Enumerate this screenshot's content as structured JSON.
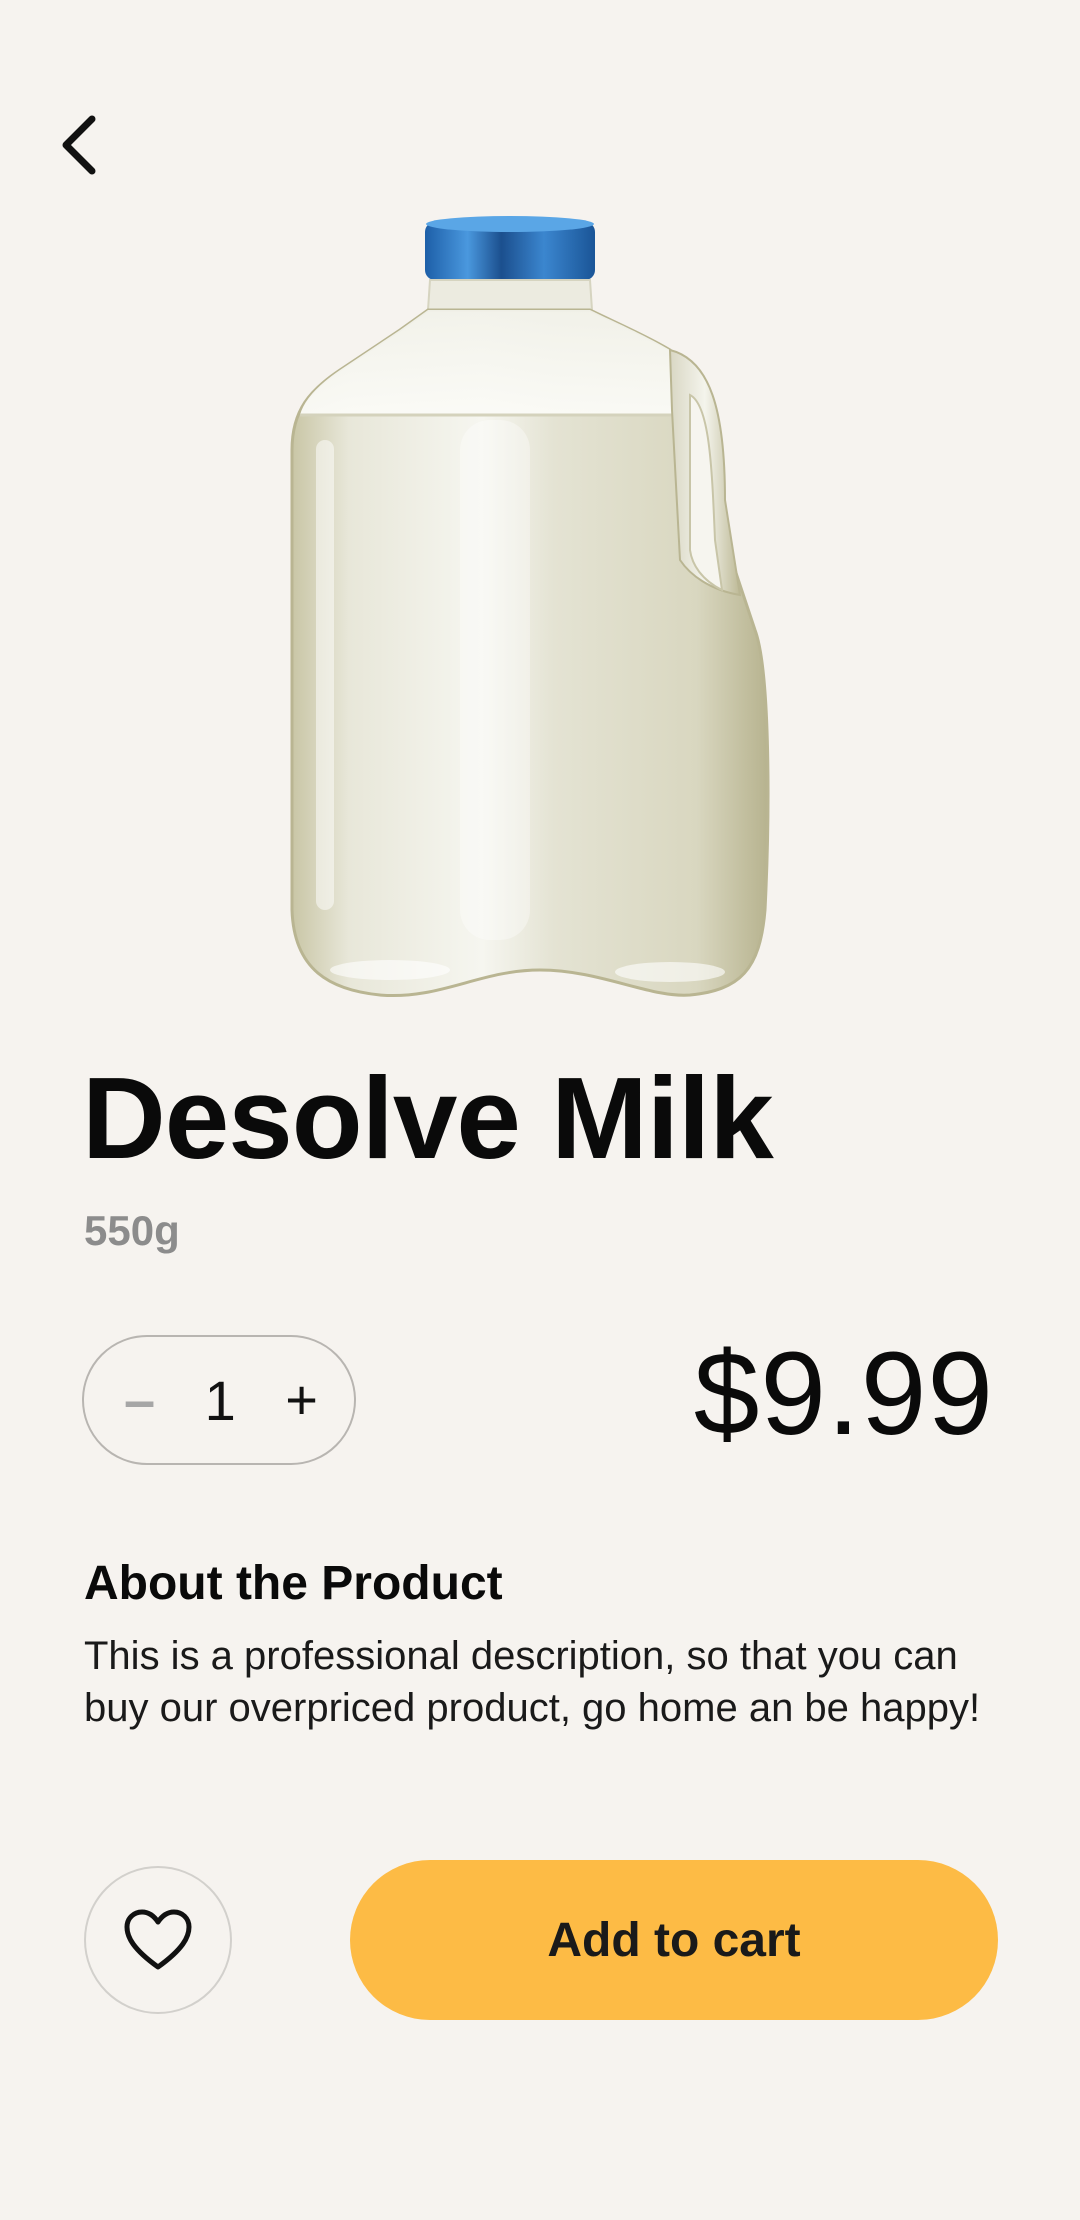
{
  "header": {
    "back_icon": "chevron-left-icon"
  },
  "product": {
    "image": "milk-jug-image",
    "name": "Desolve Milk",
    "weight": "550g",
    "price": "$9.99"
  },
  "quantity": {
    "minus_label": "–",
    "value": "1",
    "plus_label": "+"
  },
  "about": {
    "heading": "About the Product",
    "description": "This is a professional description, so that you can buy our overpriced product, go home an be happy!"
  },
  "actions": {
    "favorite_icon": "heart-icon",
    "add_to_cart_label": "Add to cart"
  },
  "colors": {
    "background": "#f6f3ef",
    "accent": "#fdbb45",
    "muted_text": "#8c8c8c",
    "cap_blue": "#2f7bc4"
  }
}
